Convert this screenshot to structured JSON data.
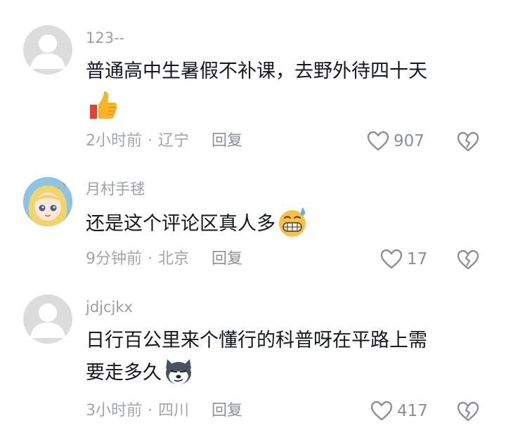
{
  "comments": [
    {
      "username": "123--",
      "text": "普通高中生暑假不补课，去野外待四十天",
      "emoji": "thumbs-up-emoji",
      "time": "2小时前",
      "location": "辽宁",
      "reply_label": "回复",
      "likes": "907",
      "avatar": "default-avatar"
    },
    {
      "username": "月村手毬",
      "text": "还是这个评论区真人多",
      "emoji": "grimacing-sweat-emoji",
      "time": "9分钟前",
      "location": "北京",
      "reply_label": "回复",
      "likes": "17",
      "avatar": "anime-girl-avatar"
    },
    {
      "username": "jdjcjkx",
      "text_line1": "日行百公里来个懂行的科普呀在平路上需",
      "text_line2": "要走多久",
      "emoji": "husky-dog-emoji",
      "time": "3小时前",
      "location": "四川",
      "reply_label": "回复",
      "likes": "417",
      "avatar": "default-avatar"
    }
  ],
  "meta_separator": "·",
  "icons": {
    "like": "heart-outline-icon",
    "dislike": "broken-heart-icon"
  },
  "colors": {
    "text": "#16181f",
    "secondary": "#9b9ea3",
    "avatar_bg": "#dcdcdc"
  }
}
